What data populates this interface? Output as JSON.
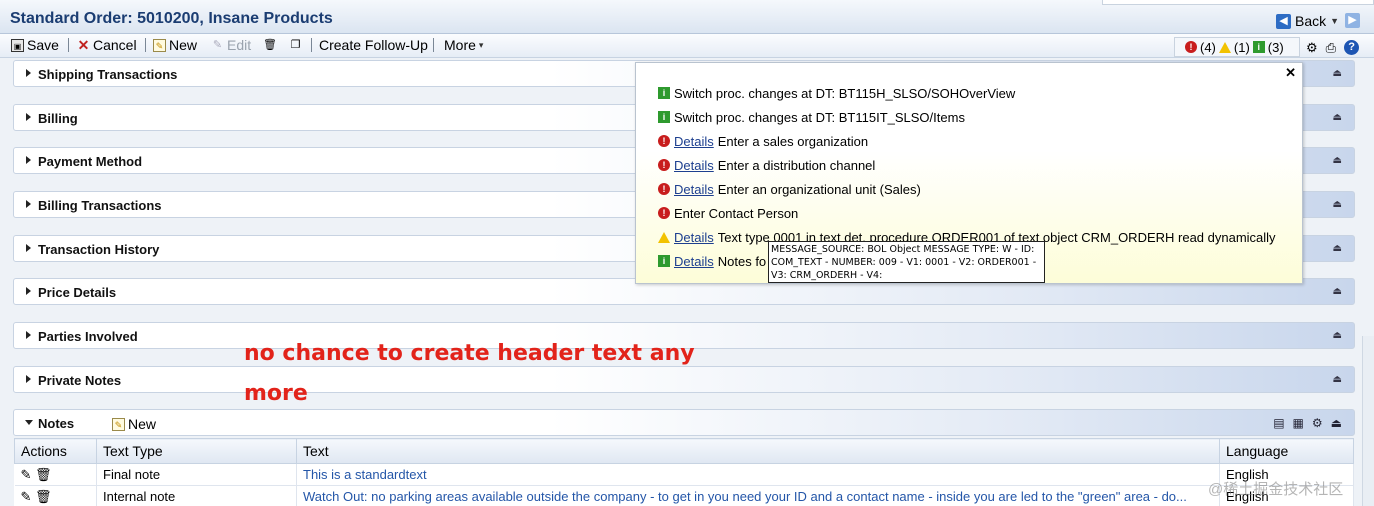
{
  "window": {
    "title": "Standard Order: 5010200, Insane Products",
    "back_label": "Back"
  },
  "toolbar": {
    "save": "Save",
    "cancel": "Cancel",
    "new": "New",
    "edit": "Edit",
    "follow_up": "Create Follow-Up",
    "more": "More"
  },
  "messages": {
    "errors": "(4)",
    "warnings": "(1)",
    "infos": "(3)"
  },
  "blocks": [
    "Shipping Transactions",
    "Billing",
    "Payment Method",
    "Billing Transactions",
    "Transaction History",
    "Price Details",
    "Parties Involved",
    "Private Notes"
  ],
  "notes": {
    "title": "Notes",
    "new": "New",
    "columns": [
      "Actions",
      "Text Type",
      "Text",
      "Language"
    ],
    "rows": [
      {
        "type": "Final note",
        "text": "This is a standardtext",
        "lang": "English"
      },
      {
        "type": "Internal note",
        "text": "Watch Out: no parking areas available outside the company - to get in you need your ID and a contact name - inside you are led to the \"green\" area - do...",
        "lang": "English"
      }
    ]
  },
  "popup": {
    "link": "Details",
    "items": [
      {
        "icon": "info",
        "text": "Switch proc. changes at DT: BT115H_SLSO/SOHOverView"
      },
      {
        "icon": "info",
        "text": "Switch proc. changes at DT: BT115IT_SLSO/Items"
      },
      {
        "icon": "error",
        "text": "Enter a sales organization"
      },
      {
        "icon": "error",
        "text": "Enter a distribution channel"
      },
      {
        "icon": "error",
        "text": "Enter an organizational unit (Sales)"
      },
      {
        "icon": "error",
        "text": "Enter Contact Person"
      },
      {
        "icon": "warning",
        "text": "Text type 0001 in text det. procedure ORDER001 of text object CRM_ORDERH read dynamically"
      },
      {
        "icon": "info",
        "text": "Notes fo"
      }
    ],
    "tooltip": [
      "MESSAGE_SOURCE: BOL Object MESSAGE TYPE: W - ID:",
      "COM_TEXT - NUMBER: 009 - V1: 0001 - V2: ORDER001 -",
      "V3: CRM_ORDERH - V4:"
    ]
  },
  "annotation": [
    "no chance to create header text any",
    "more"
  ],
  "watermark": "@稀土掘金技术社区",
  "colors": {
    "accent": "#1b3d72",
    "annotation": "#e2231a",
    "error": "#c81d1d",
    "info": "#2e9a2e",
    "warning": "#f2c200"
  }
}
